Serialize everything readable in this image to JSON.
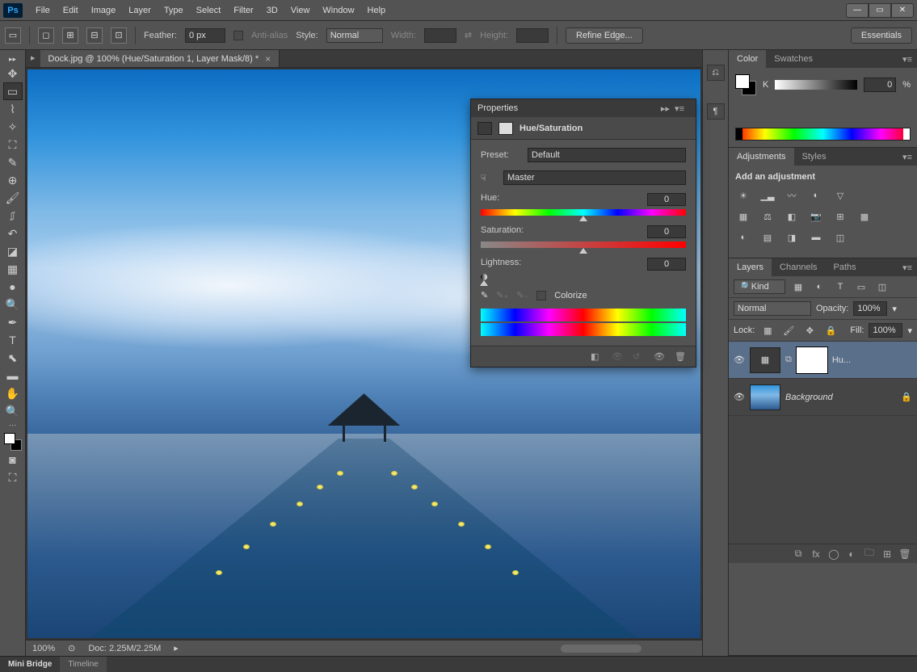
{
  "app": {
    "logo": "Ps"
  },
  "menu": [
    "File",
    "Edit",
    "Image",
    "Layer",
    "Type",
    "Select",
    "Filter",
    "3D",
    "View",
    "Window",
    "Help"
  ],
  "options_bar": {
    "feather_label": "Feather:",
    "feather_value": "0 px",
    "anti_alias": "Anti-alias",
    "style_label": "Style:",
    "style_value": "Normal",
    "width_label": "Width:",
    "height_label": "Height:",
    "refine_edge": "Refine Edge...",
    "essentials": "Essentials"
  },
  "document": {
    "tab_title": "Dock.jpg @ 100% (Hue/Saturation 1, Layer Mask/8) *",
    "zoom": "100%",
    "doc_info": "Doc: 2.25M/2.25M"
  },
  "properties": {
    "title": "Properties",
    "type": "Hue/Saturation",
    "preset_label": "Preset:",
    "preset_value": "Default",
    "channel_value": "Master",
    "hue_label": "Hue:",
    "hue_value": "0",
    "sat_label": "Saturation:",
    "sat_value": "0",
    "light_label": "Lightness:",
    "light_value": "0",
    "colorize": "Colorize"
  },
  "color_panel": {
    "tab": "Color",
    "tab2": "Swatches",
    "k_label": "K",
    "k_value": "0",
    "pct": "%"
  },
  "adjustments_panel": {
    "tab": "Adjustments",
    "tab2": "Styles",
    "title": "Add an adjustment"
  },
  "layers_panel": {
    "tabs": [
      "Layers",
      "Channels",
      "Paths"
    ],
    "kind": "Kind",
    "blend": "Normal",
    "opacity_label": "Opacity:",
    "opacity_value": "100%",
    "lock_label": "Lock:",
    "fill_label": "Fill:",
    "fill_value": "100%",
    "layers": [
      {
        "name": "Hu..."
      },
      {
        "name": "Background"
      }
    ]
  },
  "bottom_tabs": [
    "Mini Bridge",
    "Timeline"
  ]
}
